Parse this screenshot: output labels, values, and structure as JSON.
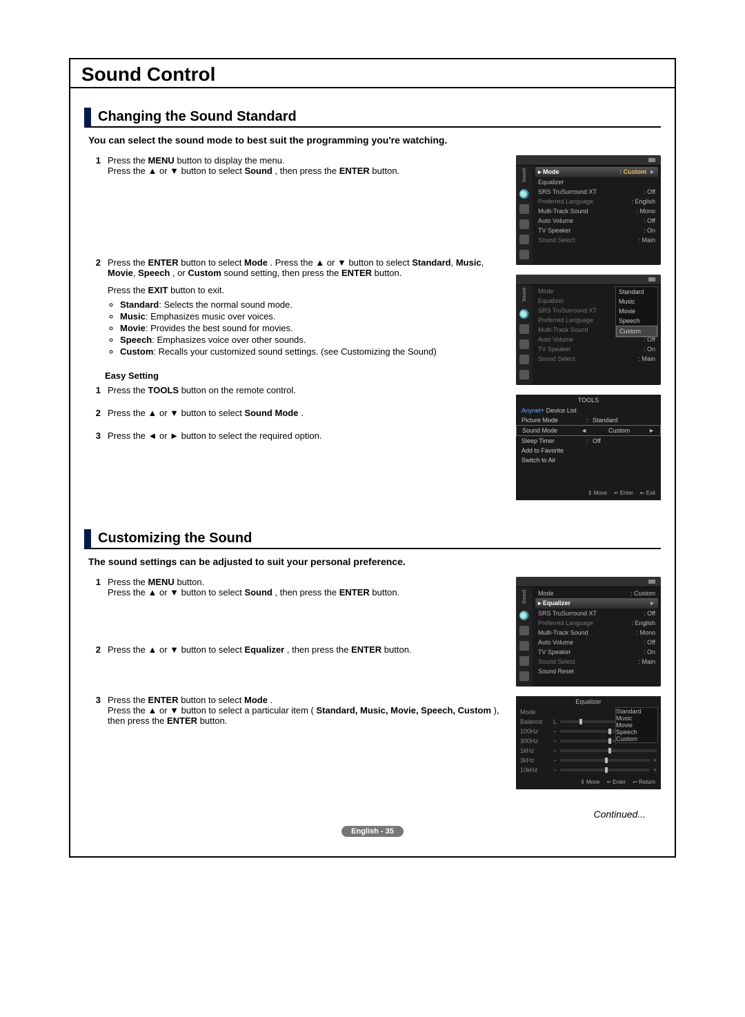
{
  "title": "Sound Control",
  "section1": {
    "heading": "Changing the Sound Standard",
    "intro": "You can select the sound mode to best suit the programming you're watching.",
    "step1a": "Press the ",
    "step1b": " button to display the menu.",
    "step1c": "Press the ▲ or ▼ button to select ",
    "step1d": ", then press the ",
    "step1e": " button.",
    "step2a": "Press the ",
    "step2b": " button to select ",
    "step2c": ". Press the ▲ or ▼ button to select ",
    "step2d": ", or ",
    "step2e": " sound setting, then press the ",
    "step2f": " button.",
    "step2g": "Press the ",
    "step2h": " button to exit.",
    "bullet1a": ": Selects the normal sound mode.",
    "bullet2a": ": Emphasizes music over voices.",
    "bullet3a": ": Provides the best sound for movies.",
    "bullet4a": ": Emphasizes voice over other sounds.",
    "bullet5a": ": Recalls your customized sound settings. (see Customizing the Sound)",
    "easyHeading": "Easy Setting",
    "easy1": "Press the ",
    "easy1b": " button on the remote control.",
    "easy2": "Press the ▲ or ▼ button to select ",
    "easy2b": ".",
    "easy3": "Press the ◄ or ► button to select the required option.",
    "menuBtn": "MENU",
    "enterBtn": "ENTER",
    "exitBtn": "EXIT",
    "soundWord": "Sound",
    "modeWord": "Mode",
    "toolsBtn": "TOOLS",
    "soundModeWord": "Sound Mode",
    "modes": {
      "standard": "Standard",
      "music": "Music",
      "movie": "Movie",
      "speech": "Speech",
      "custom": "Custom"
    }
  },
  "section2": {
    "heading": "Customizing the Sound",
    "intro": "The sound settings can be adjusted to suit your personal preference.",
    "step1a": "Press the ",
    "step1b": " button.",
    "step1c": "Press the ▲ or ▼ button to select ",
    "step1d": ", then press the ",
    "step1e": " button.",
    "step2a": "Press the ▲ or ▼ button to select ",
    "step2b": ", then press the ",
    "step2c": " button.",
    "step3a": "Press the ",
    "step3b": " button to select ",
    "step3c": ".",
    "step3d": "Press the ▲ or ▼ button to select a particular item (",
    "step3e": "), then press the ",
    "step3f": " button.",
    "equalizerWord": "Equalizer",
    "itemList": "Standard, Music, Movie, Speech, Custom"
  },
  "osd_sound_label": "Sound",
  "osdMenu1": {
    "mode": "Mode",
    "modeVal": ": Custom",
    "equalizer": "Equalizer",
    "srs": "SRS TruSurround XT",
    "srsVal": ": Off",
    "preflang": "Preferred Language",
    "preflangVal": ": English",
    "mts": "Multi-Track Sound",
    "mtsVal": ": Mono",
    "autovol": "Auto Volume",
    "autovolVal": ": Off",
    "tvspk": "TV Speaker",
    "tvspkVal": ": On",
    "ssel": "Sound Select",
    "sselVal": ": Main",
    "sreset": "Sound Reset"
  },
  "toolsPanel": {
    "title": "TOOLS",
    "deviceList": "Device List",
    "picMode": "Picture Mode",
    "picModeVal": "Standard",
    "soundMode": "Sound Mode",
    "soundModeVal": "Custom",
    "sleep": "Sleep Timer",
    "sleepVal": "Off",
    "addfav": "Add to Favorite",
    "switch": "Switch to Air",
    "move": "Move",
    "enter": "Enter",
    "exit": "Exit"
  },
  "eqPanel": {
    "title": "Equalizer",
    "mode": "Mode",
    "balance": "Balance",
    "balanceL": "L",
    "h100": "100Hz",
    "h300": "300Hz",
    "h1k": "1kHz",
    "h3k": "3kHz",
    "h10k": "10kHz",
    "move": "Move",
    "enter": "Enter",
    "return": "Return"
  },
  "continued": "Continued...",
  "footer": "English - 35",
  "nums": {
    "n1": "1",
    "n2": "2",
    "n3": "3"
  },
  "glyph": {
    "updown": "⇕",
    "enterIcon": "↵",
    "exitIcon": "⇤",
    "returnIcon": "↩",
    "tri_r": "►",
    "tri_l": "◄",
    "dot": "▸",
    "colon": ":",
    "minus": "−",
    "plus": "+",
    "anynet": "Anynet+"
  }
}
